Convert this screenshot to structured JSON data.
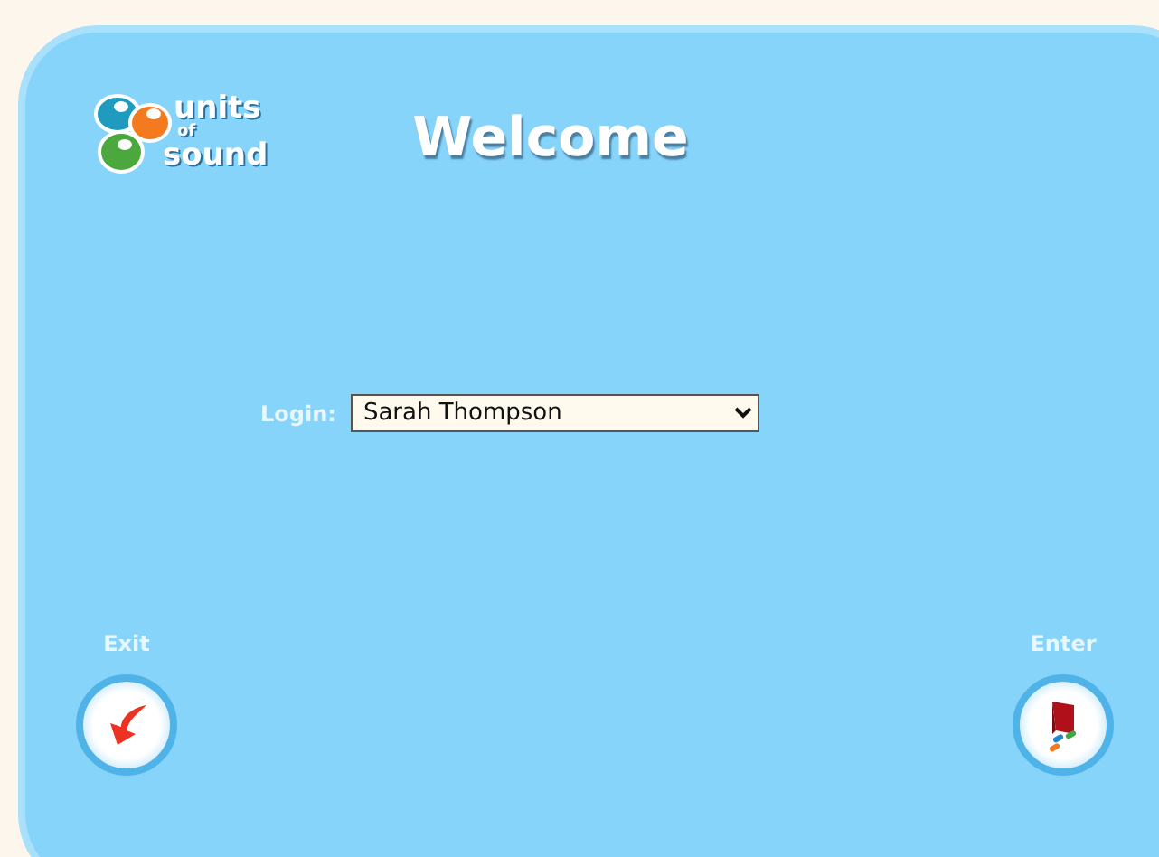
{
  "logo": {
    "line_1": "units",
    "line_2": "of",
    "line_3": "sound"
  },
  "title": "Welcome",
  "login": {
    "label": "Login:",
    "value": "Sarah Thompson"
  },
  "exit": {
    "label": "Exit"
  },
  "enter": {
    "label": "Enter"
  }
}
